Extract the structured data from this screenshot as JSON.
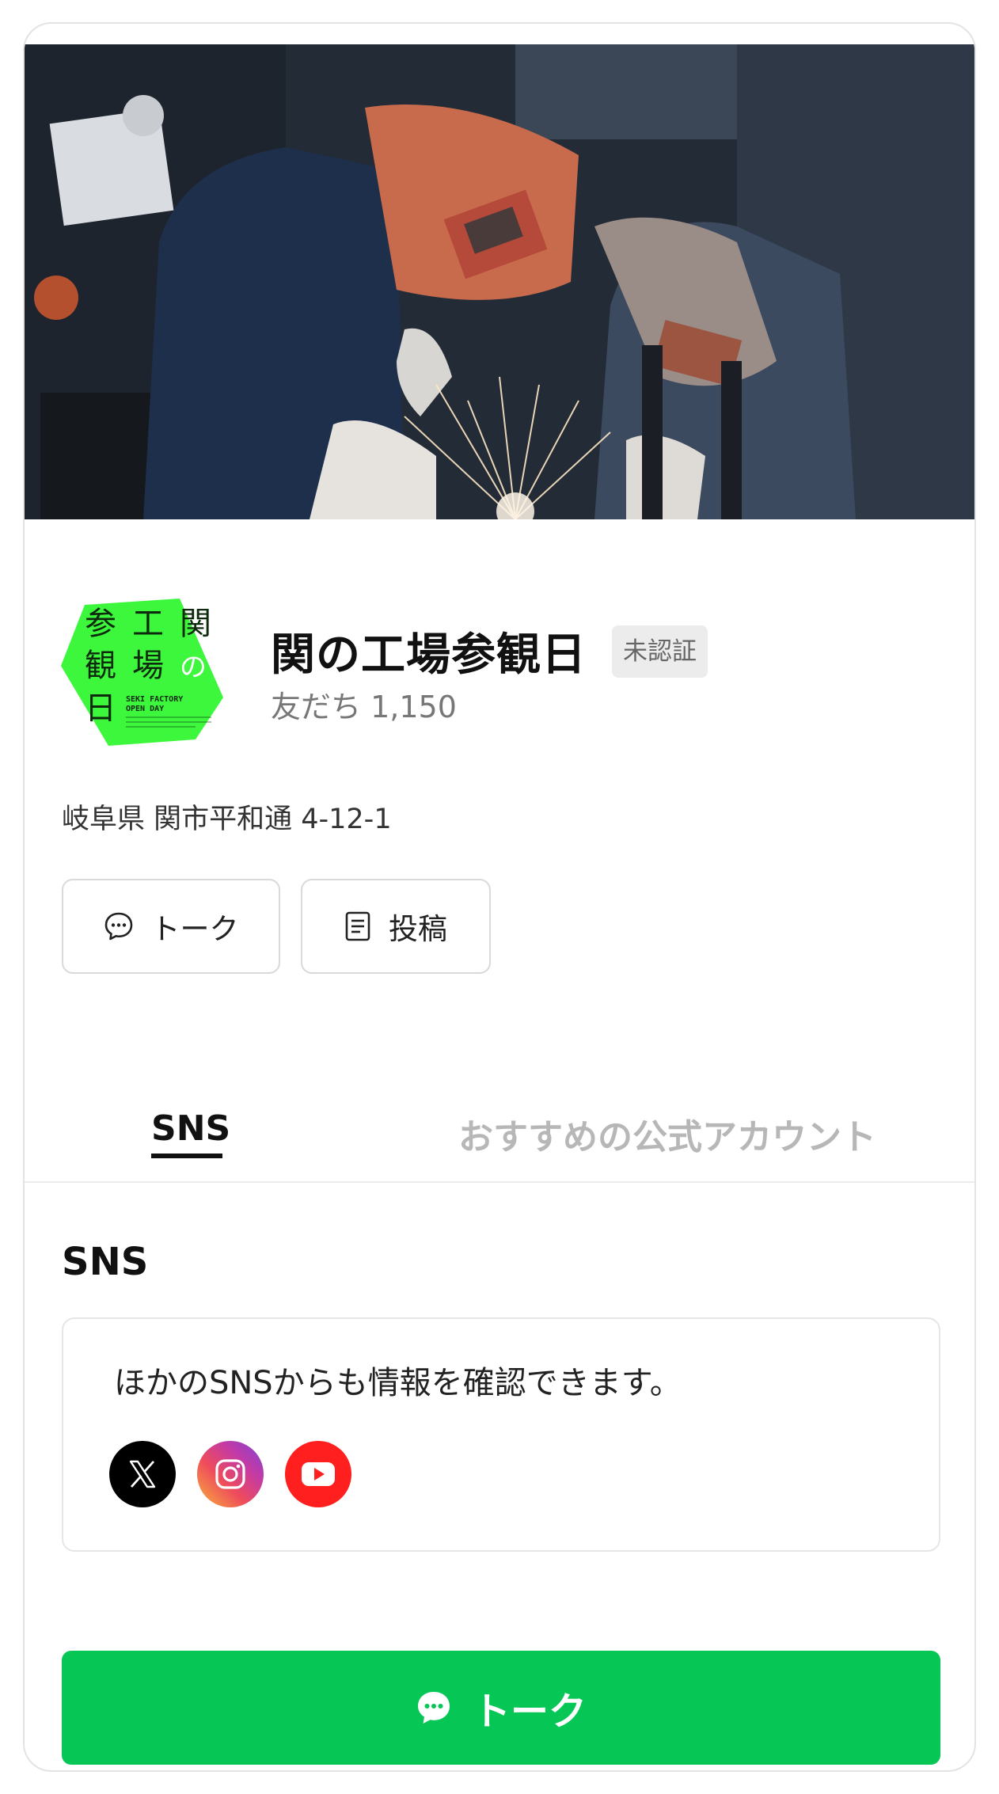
{
  "cover": {
    "alt": "welding workers cover image"
  },
  "profile": {
    "logo": {
      "chars": [
        "参",
        "工",
        "関",
        "観",
        "場",
        "の",
        "日"
      ],
      "sub": [
        "SEKI FACTORY",
        "OPEN DAY"
      ],
      "color": "#39ff3a"
    },
    "name": "関の工場参観日",
    "badge": "未認証",
    "friends": "友だち 1,150",
    "address": "岐阜県 関市平和通 4-12-1",
    "talk_button": "トーク",
    "post_button": "投稿"
  },
  "tabs": [
    {
      "label": "SNS",
      "active": true
    },
    {
      "label": "おすすめの公式アカウント",
      "active": false
    }
  ],
  "sns_section": {
    "title": "SNS",
    "description": "ほかのSNSからも情報を確認できます。",
    "icons": [
      "x-icon",
      "instagram-icon",
      "youtube-icon"
    ]
  },
  "cta": {
    "label": "トーク",
    "color": "#06c755"
  }
}
